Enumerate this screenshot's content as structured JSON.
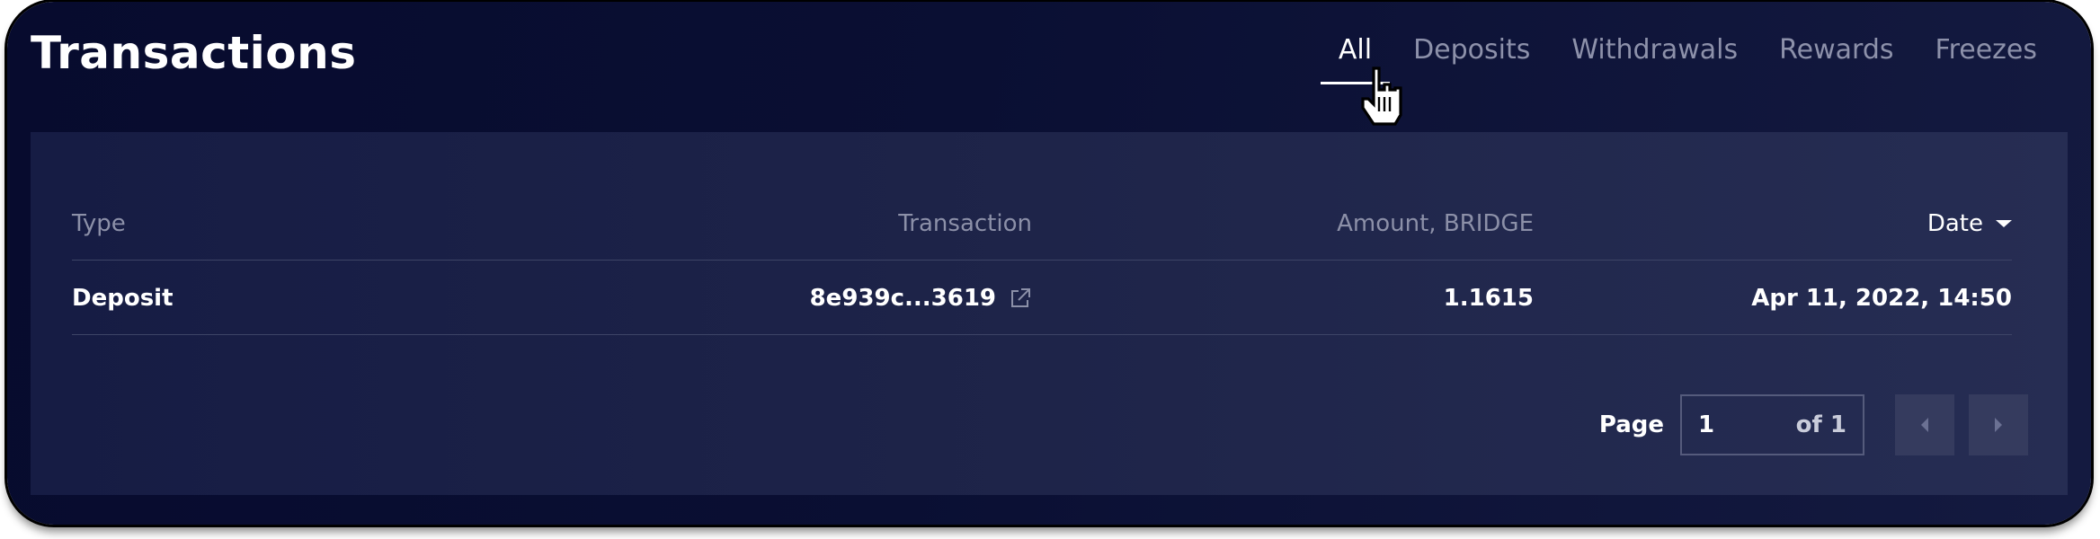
{
  "header": {
    "title": "Transactions",
    "tabs": [
      {
        "label": "All",
        "active": true
      },
      {
        "label": "Deposits",
        "active": false
      },
      {
        "label": "Withdrawals",
        "active": false
      },
      {
        "label": "Rewards",
        "active": false
      },
      {
        "label": "Freezes",
        "active": false
      }
    ]
  },
  "table": {
    "columns": {
      "type": "Type",
      "transaction": "Transaction",
      "amount": "Amount, BRIDGE",
      "date": "Date"
    },
    "sort": {
      "column": "Date",
      "direction": "descending"
    },
    "rows": [
      {
        "type": "Deposit",
        "transaction": "8e939c...3619",
        "transaction_icon": "external-link-icon",
        "amount": "1.1615",
        "date": "Apr 11, 2022, 14:50"
      }
    ]
  },
  "pagination": {
    "label": "Page",
    "current": "1",
    "of_text": "of 1",
    "prev_icon": "caret-left-icon",
    "next_icon": "caret-right-icon"
  },
  "colors": {
    "background": "#070b2e",
    "panel": "#1e2449",
    "text_primary": "#ffffff",
    "text_muted": "#8c90a8"
  }
}
